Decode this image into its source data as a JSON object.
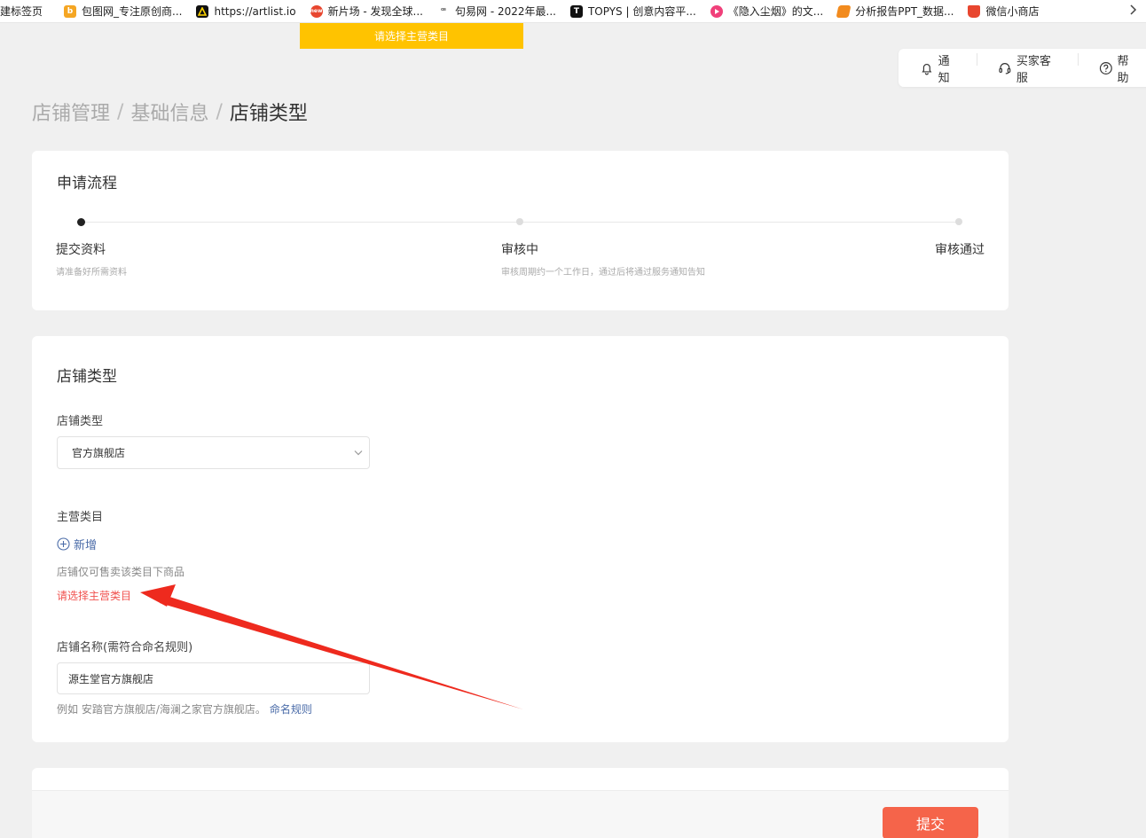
{
  "bookmarks": [
    {
      "label": "建标签页",
      "icon": "none",
      "color": ""
    },
    {
      "label": "包图网_专注原创商...",
      "icon": "baotu-icon",
      "color": "#f5a623"
    },
    {
      "label": "https://artlist.io",
      "icon": "artlist-icon",
      "color": "#111111"
    },
    {
      "label": "新片场 - 发现全球...",
      "icon": "xinpianchang-icon",
      "color": "#e8462f"
    },
    {
      "label": "句易网 - 2022年最...",
      "icon": "juyi-icon",
      "color": "#666666"
    },
    {
      "label": "TOPYS | 创意内容平...",
      "icon": "topys-icon",
      "color": "#111111"
    },
    {
      "label": "《隐入尘烟》的文...",
      "icon": "bilibili-icon",
      "color": "#f0407a"
    },
    {
      "label": "分析报告PPT_数据...",
      "icon": "report-icon",
      "color": "#f28b1e"
    },
    {
      "label": "微信小商店",
      "icon": "wechat-shop-icon",
      "color": "#e8462f"
    }
  ],
  "toast": {
    "text": "请选择主营类目",
    "color": "#ffc300"
  },
  "toolbar": {
    "notify": "通知",
    "service": "买家客服",
    "help": "帮助"
  },
  "breadcrumb": {
    "level1": "店铺管理",
    "level2": "基础信息",
    "current": "店铺类型",
    "separator": "/"
  },
  "process": {
    "title": "申请流程",
    "steps": [
      {
        "label": "提交资料",
        "desc": "请准备好所需资料",
        "active": true
      },
      {
        "label": "审核中",
        "desc": "审核周期约一个工作日，通过后将通过服务通知告知",
        "active": false
      },
      {
        "label": "审核通过",
        "desc": "",
        "active": false
      }
    ]
  },
  "shop": {
    "section_title": "店铺类型",
    "type_label": "店铺类型",
    "type_value": "官方旗舰店",
    "category_label": "主营类目",
    "add_label": "新增",
    "category_hint": "店铺仅可售卖该类目下商品",
    "category_error": "请选择主营类目",
    "name_label": "店铺名称(需符合命名规则)",
    "name_value": "源生堂官方旗舰店",
    "name_example": "例如 安踏官方旗舰店/海澜之家官方旗舰店。",
    "name_rule_link": "命名规则"
  },
  "footer": {
    "submit": "提交",
    "submit_color": "#f5644a"
  },
  "colors": {
    "link": "#4a6ba8",
    "error": "#f0524f",
    "annotation_arrow": "#ee2a1e"
  }
}
